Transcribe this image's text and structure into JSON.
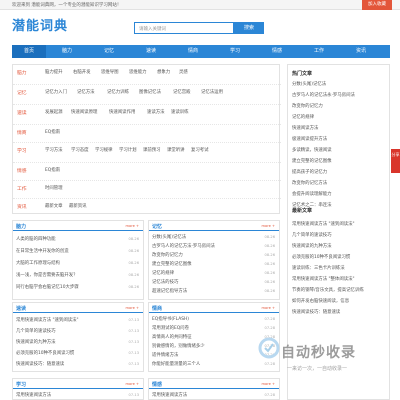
{
  "topbar": {
    "welcome": "欢迎来到 潜能词典网，一个专业的潜能知识学习网站！",
    "join": "加入收藏"
  },
  "logo": "潜能词典",
  "search": {
    "placeholder": "请输入关键词",
    "button": "搜索"
  },
  "nav": [
    "首页",
    "脑力",
    "记忆",
    "速读",
    "情商",
    "学习",
    "情感",
    "工作",
    "资讯"
  ],
  "categories": [
    {
      "name": "脑力",
      "links": [
        "脑力提升",
        "右脑开发",
        "思维导图",
        "思维能力",
        "想象力",
        "灵感"
      ]
    },
    {
      "name": "记忆",
      "links": [
        "记忆力入门",
        "记忆方法",
        "记忆力训练",
        "图像记忆法",
        "记忆宫殿",
        "记忆法运用"
      ]
    },
    {
      "name": "速读",
      "links": [
        "发展起源",
        "快速阅读原理",
        "快速阅读作用",
        "速读方法",
        "速读训练"
      ]
    },
    {
      "name": "情商",
      "links": [
        "EQ指南"
      ]
    },
    {
      "name": "学习",
      "links": [
        "学习方法",
        "学习态度",
        "学习规律",
        "学习计划",
        "课前预习",
        "课堂听讲",
        "复习考试"
      ]
    },
    {
      "name": "情感",
      "links": [
        "EQ指南"
      ]
    },
    {
      "name": "工作",
      "links": [
        "时间管理"
      ]
    },
    {
      "name": "资讯",
      "links": [
        "最新文章",
        "最新资讯"
      ]
    }
  ],
  "sidebar": {
    "hot_title": "热门文章",
    "hot": [
      "分数(头尾)记忆法",
      "古罗马人的记忆法永·罗马房间法",
      "改变你的记忆力",
      "记忆的规律",
      "快速阅读方法",
      "极速阅读提升方法",
      "多读精读，快速阅读",
      "建立完整的记忆图像",
      "提高孩子的记忆力",
      "改变你的记忆方法",
      "会提升阅读理解能力",
      "记忆术之二：串连法"
    ],
    "rec_title": "最新文章",
    "rec": [
      "常用快速阅读方法 \"速到阅读法\"",
      "几个简单的速读技巧",
      "快速阅读的九种方法",
      "必须克服的10种不良阅读习惯",
      "速读训练：三色卡片训练法",
      "常用快速阅读方法 \"整体阅读法\"",
      "节奏的钢琴/音乐文具，提高记忆训练",
      "如何开发右脑快速阅读，信息",
      "快速阅读技巧：随意速读"
    ]
  },
  "panels": [
    {
      "title": "脑力",
      "more": "more +",
      "items": [
        "人类的脑的四种功能",
        "在日常生活中开发你的创造",
        "大脑的工作原理与结构",
        "浅一浅，你是否需要去脑开发？",
        "同行右脑学会右脑记忆10大步骤"
      ],
      "dates": [
        "08-26",
        "08-26",
        "08-26",
        "08-26",
        "08-26"
      ]
    },
    {
      "title": "记忆",
      "more": "more +",
      "items": [
        "分数(头尾)记忆法",
        "古罗马人的记忆方法·罗马房间法",
        "改变你的记忆力",
        "建立完整的记忆图像",
        "记忆的规律",
        "记忆法的技巧",
        "超速记忆指导方法"
      ],
      "dates": [
        "08-26",
        "08-26",
        "08-26",
        "08-26",
        "08-26",
        "08-26",
        "08-26"
      ]
    },
    {
      "title": "速读",
      "more": "more +",
      "items": [
        "常用快速阅读方法 \"速到阅读法\"",
        "几个简单的速读技巧",
        "快速阅读的九种方法",
        "必须克服的10种不良阅读习惯",
        "快速阅读技巧：随意速读"
      ],
      "dates": [
        "07-13",
        "07-13",
        "07-13",
        "07-13",
        "07-13"
      ]
    },
    {
      "title": "情商",
      "more": "more +",
      "items": [
        "EQ指导书(FLASH)",
        "常用测试的EQ问卷",
        "高情商人的共同特征",
        "别做感情的，别做情绪多少",
        "适件情绪方法",
        "你能好能量测量的三个人"
      ],
      "dates": [
        "07-28",
        "07-28",
        "07-28",
        "07-28",
        "07-28",
        "07-28"
      ]
    },
    {
      "title": "学习",
      "more": "more +",
      "items": [
        "常用快速阅读方法"
      ],
      "dates": [
        "07-13"
      ]
    },
    {
      "title": "情感",
      "more": "more +",
      "items": [
        "常用快速阅读方法"
      ],
      "dates": [
        "07-28"
      ]
    }
  ],
  "badge": "分享",
  "watermark": {
    "text": "自动秒收录",
    "sub": "一来访一次，一自动收录一"
  }
}
